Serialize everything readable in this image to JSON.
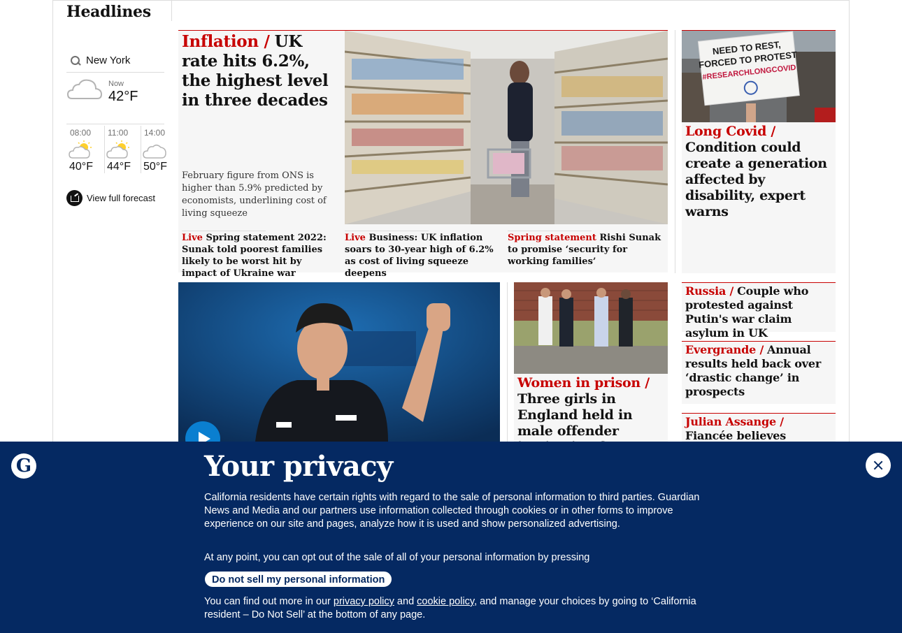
{
  "section": {
    "title": "Headlines"
  },
  "weather": {
    "location": "New York",
    "now": {
      "label": "Now",
      "temp": "42°F",
      "icon": "cloud-icon"
    },
    "hourly": [
      {
        "time": "08:00",
        "temp": "40°F",
        "icon": "sun-cloud-icon"
      },
      {
        "time": "11:00",
        "temp": "44°F",
        "icon": "sun-cloud-icon"
      },
      {
        "time": "14:00",
        "temp": "50°F",
        "icon": "cloud-icon"
      }
    ],
    "forecast_link": "View full forecast"
  },
  "main_story": {
    "kicker": "Inflation /",
    "headline": "UK rate hits 6.2%, the highest level in three decades",
    "standfirst": "February figure from ONS is higher than 5.9% predicted by economists, underlining cost of living squeeze",
    "sublinks": [
      {
        "kicker": "Live",
        "text": "Spring statement 2022: Sunak told poorest families likely to be worst hit by impact of Ukraine war"
      },
      {
        "kicker": "Live",
        "text": "Business: UK inflation soars to 30-year high of 6.2% as cost of living squeeze deepens"
      },
      {
        "kicker": "Spring statement",
        "text": "Rishi Sunak to promise ‘security for working families’"
      }
    ]
  },
  "covid_story": {
    "kicker": "Long Covid /",
    "headline": "Condition could create a generation affected by disability, expert warns",
    "sign_lines": [
      "NEED TO REST,",
      "FORCED TO PROTEST",
      "#RESEARCHLONGCOVID"
    ]
  },
  "prison_story": {
    "kicker": "Women in prison /",
    "headline": "Three girls in England held in male offender institution for months"
  },
  "side_stories": [
    {
      "kicker": "Russia /",
      "headline": "Couple who protested against Putin's war claim asylum in UK"
    },
    {
      "kicker": "Evergrande /",
      "headline": "Annual results held back over ‘drastic change’ in prospects"
    },
    {
      "kicker": "Julian Assange /",
      "headline": "Fiancée believes journalists barred"
    }
  ],
  "privacy": {
    "title": "Your privacy",
    "paragraph1": "California residents have certain rights with regard to the sale of personal information to third parties. Guardian News and Media and our partners use information collected through cookies or in other forms to improve experience on our site and pages, analyze how it is used and show personalized advertising.",
    "paragraph2": "At any point, you can opt out of the sale of all of your personal information by pressing",
    "dns_button": "Do not sell my personal information",
    "p3_start": "You can find out more in our ",
    "privacy_policy": "privacy policy",
    "p3_and": " and ",
    "cookie_policy": "cookie policy",
    "p3_end": ", and manage your choices by going to ‘California resident – Do Not Sell’ at the bottom of any page."
  },
  "colors": {
    "accent": "#c70000",
    "brand": "#052962",
    "play": "#0a7fd0"
  }
}
